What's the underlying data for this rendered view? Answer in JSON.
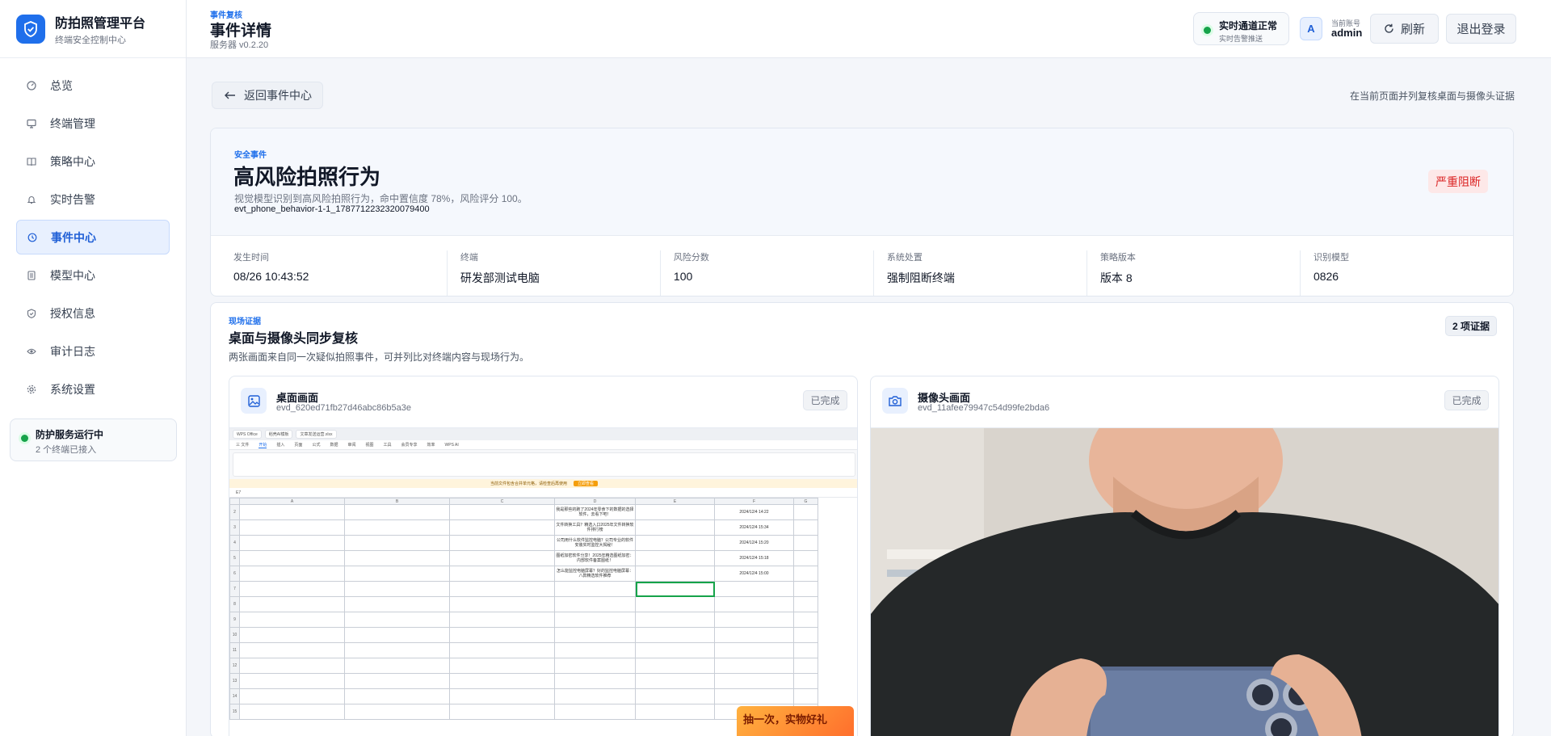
{
  "brand": {
    "title": "防拍照管理平台",
    "subtitle": "终端安全控制中心"
  },
  "nav": [
    {
      "label": "总览",
      "icon": "dashboard-icon",
      "active": false
    },
    {
      "label": "终端管理",
      "icon": "monitor-icon",
      "active": false
    },
    {
      "label": "策略中心",
      "icon": "book-icon",
      "active": false
    },
    {
      "label": "实时告警",
      "icon": "bell-icon",
      "active": false
    },
    {
      "label": "事件中心",
      "icon": "history-icon",
      "active": true
    },
    {
      "label": "模型中心",
      "icon": "list-icon",
      "active": false
    },
    {
      "label": "授权信息",
      "icon": "shield-check-icon",
      "active": false
    },
    {
      "label": "审计日志",
      "icon": "eye-icon",
      "active": false
    },
    {
      "label": "系统设置",
      "icon": "gear-icon",
      "active": false
    }
  ],
  "service": {
    "title": "防护服务运行中",
    "subtitle": "2 个终端已接入"
  },
  "header": {
    "breadcrumb": "事件复核",
    "title": "事件详情",
    "server_version": "服务器 v0.2.20",
    "status_title": "实时通道正常",
    "status_subtitle": "实时告警推送",
    "avatar_letter": "A",
    "account_label": "当前账号",
    "account_name": "admin",
    "refresh_label": "刷新",
    "logout_label": "退出登录"
  },
  "back_label": "返回事件中心",
  "hint": "在当前页面并列复核桌面与摄像头证据",
  "event": {
    "kicker": "安全事件",
    "title": "高风险拍照行为",
    "description": "视觉模型识别到高风险拍照行为，命中置信度 78%，风险评分 100。",
    "event_id": "evt_phone_behavior-1-1_1787712232320079400",
    "severity": "严重阻断",
    "severity_color": "#dc2626",
    "meta": [
      {
        "label": "发生时间",
        "value": "08/26 10:43:52"
      },
      {
        "label": "终端",
        "value": "研发部测试电脑"
      },
      {
        "label": "风险分数",
        "value": "100"
      },
      {
        "label": "系统处置",
        "value": "强制阻断终端"
      },
      {
        "label": "策略版本",
        "value": "版本 8"
      },
      {
        "label": "识别模型",
        "value": "0826"
      }
    ]
  },
  "evidence": {
    "kicker": "现场证据",
    "title": "桌面与摄像头同步复核",
    "description": "两张画面来自同一次疑似拍照事件，可并列比对终端内容与现场行为。",
    "count": "2 项证据",
    "desktop": {
      "title": "桌面画面",
      "id": "evd_620ed71fb27d46abc86b5a3e",
      "status": "已完成",
      "icon": "image-icon"
    },
    "camera": {
      "title": "摄像头画面",
      "id": "evd_11afee79947c54d99fe2bda6",
      "status": "已完成",
      "icon": "camera-icon"
    }
  },
  "screenshot": {
    "tabs": [
      "WPS Office",
      "稻壳AI模板",
      "文章发送运营.xlsx"
    ],
    "menu": [
      "三 文件",
      "开始",
      "插入",
      "页面",
      "公式",
      "数据",
      "审阅",
      "视图",
      "工具",
      "会员专享",
      "效率",
      "WPS AI"
    ],
    "active_menu": "开始",
    "warning": "当前文件包含合并单元格，请检查后再使用",
    "warning_action": "立即查看",
    "cell_ref": "E7",
    "columns": [
      "A",
      "B",
      "C",
      "D",
      "E",
      "F",
      "G"
    ],
    "rows": [
      {
        "n": "2",
        "d": "我是那些的跑了2024年零食下的数据的选择软件，去看下吧！",
        "f": "2024/12/4 14:22"
      },
      {
        "n": "3",
        "d": "文件转换工具？精选入口2025年文件转换软件排行榜",
        "f": "2024/12/4 15:34"
      },
      {
        "n": "4",
        "d": "公司用什么软件监控电脑？公司专业的软件安装实时监控大揭秘！",
        "f": "2024/12/4 15:20"
      },
      {
        "n": "5",
        "d": "图纸加密软件分享！2025年精选图纸加密：内部软件备案图纸！",
        "f": "2024/12/4 15:18"
      },
      {
        "n": "6",
        "d": "怎么能监控电脑屏幕？好的监控电脑屏幕：八款精选软件推荐",
        "f": "2024/12/4 15:00"
      },
      {
        "n": "7",
        "d": "",
        "f": ""
      },
      {
        "n": "8",
        "d": "",
        "f": ""
      },
      {
        "n": "9",
        "d": "",
        "f": ""
      },
      {
        "n": "10",
        "d": "",
        "f": ""
      },
      {
        "n": "11",
        "d": "",
        "f": ""
      },
      {
        "n": "12",
        "d": "",
        "f": ""
      },
      {
        "n": "13",
        "d": "",
        "f": ""
      },
      {
        "n": "14",
        "d": "",
        "f": ""
      },
      {
        "n": "15",
        "d": "",
        "f": ""
      }
    ],
    "ad_text": "抽一次，实物好礼"
  }
}
